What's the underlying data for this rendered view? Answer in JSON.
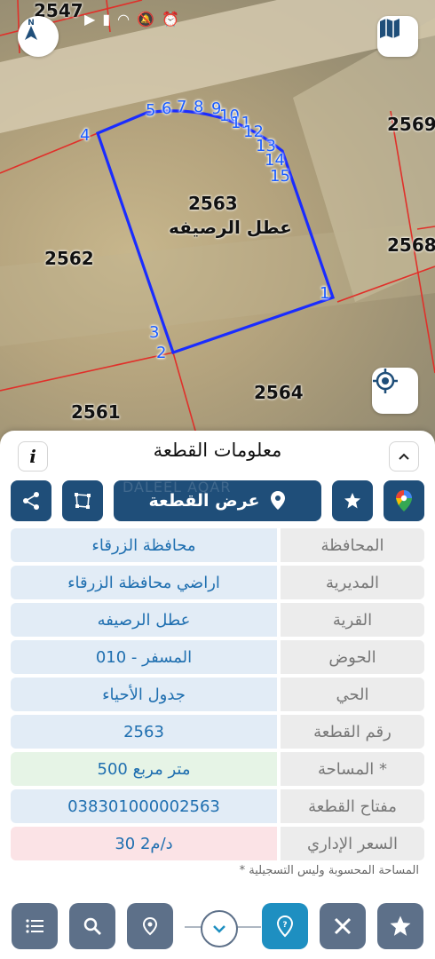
{
  "status_bar": {
    "icons": [
      "arrow-icon",
      "signal-icon",
      "wifi-icon",
      "mute-icon",
      "alarm-icon"
    ]
  },
  "map": {
    "plots": {
      "p2547": "2547",
      "p2569": "2569",
      "p2568": "2568",
      "p2563": "2563",
      "p2562": "2562",
      "p2564": "2564",
      "p2561": "2561"
    },
    "selected_village": "عطل الرصيفه",
    "vertices": [
      "1",
      "2",
      "3",
      "4",
      "5",
      "6",
      "7",
      "8",
      "9",
      "10",
      "11",
      "12",
      "13",
      "14",
      "15"
    ]
  },
  "panel": {
    "title": "معلومات القطعة",
    "info_label": "i",
    "show_parcel_label": "عرض القطعة",
    "watermark": "DALEEL AQAR",
    "rows": [
      {
        "label": "المحافظة",
        "value": "محافظة الزرقاء",
        "tone": "blue"
      },
      {
        "label": "المديرية",
        "value": "اراضي محافظة الزرقاء",
        "tone": "blue"
      },
      {
        "label": "القرية",
        "value": "عطل الرصيفه",
        "tone": "blue"
      },
      {
        "label": "الحوض",
        "value": "المسفر - 010",
        "tone": "blue"
      },
      {
        "label": "الحي",
        "value": "جدول الأحياء",
        "tone": "blue"
      },
      {
        "label": "رقم القطعة",
        "value": "2563",
        "tone": "blue"
      },
      {
        "label": "المساحة *",
        "value": "500  متر مربع",
        "tone": "green"
      },
      {
        "label": "مفتاح القطعة",
        "value": "038301000002563",
        "tone": "blue"
      },
      {
        "label": "السعر الإداري",
        "value": "30 د/م2",
        "tone": "red"
      }
    ],
    "footnote": "* المساحة المحسوبة وليس التسجيلية"
  },
  "colors": {
    "navy": "#1f4e79",
    "parcel_line": "#1a2cff",
    "teal": "#1e8fc1",
    "slate": "#5d7089"
  }
}
